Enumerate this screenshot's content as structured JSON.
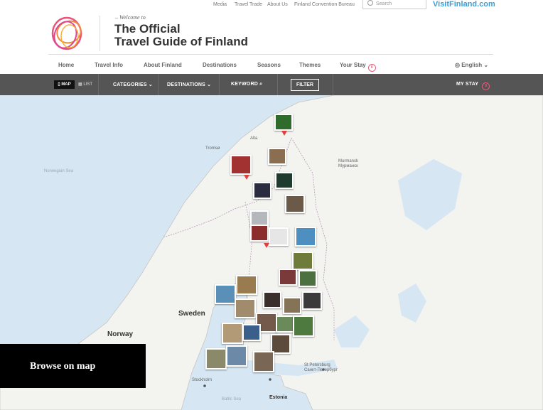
{
  "utility": {
    "links": [
      "Media",
      "Travel Trade",
      "About Us",
      "Finland Convention Bureau"
    ],
    "search_placeholder": "Search",
    "brand": "VisitFinland.com"
  },
  "header": {
    "tagline": "– Welcome to",
    "title_line1": "The Official",
    "title_line2": "Travel Guide of Finland"
  },
  "nav": {
    "items": [
      "Home",
      "Travel Info",
      "About Finland",
      "Destinations",
      "Seasons",
      "Themes",
      "Your Stay"
    ],
    "your_stay_count": "0",
    "language": "English"
  },
  "filterbar": {
    "map": "MAP",
    "list": "LIST",
    "categories": "CATEGORIES",
    "destinations": "DESTINATIONS",
    "keyword": "KEYWORD",
    "filter": "FILTER",
    "my_stay": "MY STAY",
    "my_stay_count": "0"
  },
  "map": {
    "places": [
      {
        "name": "Alta",
        "big": false
      },
      {
        "name": "Tromsø",
        "big": false
      },
      {
        "name": "Murmansk\nМурманск",
        "big": false
      },
      {
        "name": "Norwegian Sea",
        "big": false
      },
      {
        "name": "Sweden",
        "big": true
      },
      {
        "name": "Norway",
        "big": true
      },
      {
        "name": "Stockholm",
        "big": false
      },
      {
        "name": "Tallinn",
        "big": false
      },
      {
        "name": "St Petersburg\nСанкт-Петербург",
        "big": false
      },
      {
        "name": "Estonia",
        "big": false
      },
      {
        "name": "Baltic Sea",
        "big": false
      }
    ]
  },
  "overlay": {
    "browse_label": "Browse on map"
  },
  "colors": {
    "accent": "#e85c7a",
    "brand_blue": "#3aa0d8",
    "filterbar": "#555555",
    "water": "#d6e6f2",
    "land": "#f3f3f0"
  }
}
